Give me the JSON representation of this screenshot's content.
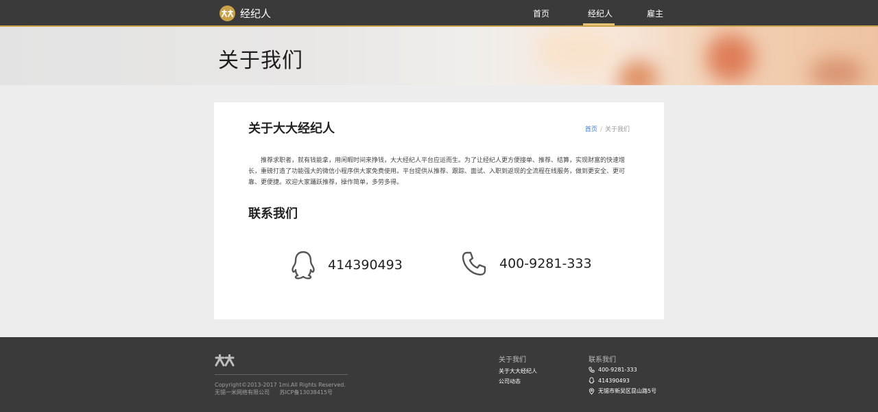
{
  "header": {
    "brand": "经纪人",
    "nav": [
      {
        "label": "首页"
      },
      {
        "label": "经纪人"
      },
      {
        "label": "雇主"
      }
    ]
  },
  "hero": {
    "title": "关于我们"
  },
  "about": {
    "title": "关于大大经纪人",
    "breadcrumb": {
      "home": "首页",
      "separator": "/",
      "current": "关于我们"
    },
    "intro": "推荐求职者，就有钱能拿，用闲暇时间来挣钱，大大经纪人平台应运而生。为了让经纪人更方便接单、推荐、结算，实现财富的快速增长，重磅打造了功能强大的微信小程序供大家免费使用。平台提供从推荐、跟踪、面试、入职到返现的全流程在线服务，做到更安全、更可靠、更便捷。欢迎大家踊跃推荐，操作简单，多劳多得。",
    "contact_title": "联系我们",
    "qq": "414390493",
    "phone": "400-9281-333"
  },
  "footer": {
    "copyright": "Copyright©2013-2017 1mi.All Rights Reserved.",
    "company": "无锡一米网络有限公司",
    "icp": "苏ICP备13038415号",
    "about_title": "关于我们",
    "about_links": [
      "关于大大经纪人",
      "公司动态"
    ],
    "contact_title": "联系我们",
    "phone": "400-9281-333",
    "qq": "414390493",
    "address": "无锡市新吴区昆山路5号"
  },
  "colors": {
    "accent": "#c9a24a",
    "dark": "#3a3a3a",
    "link": "#3a7bd5"
  }
}
